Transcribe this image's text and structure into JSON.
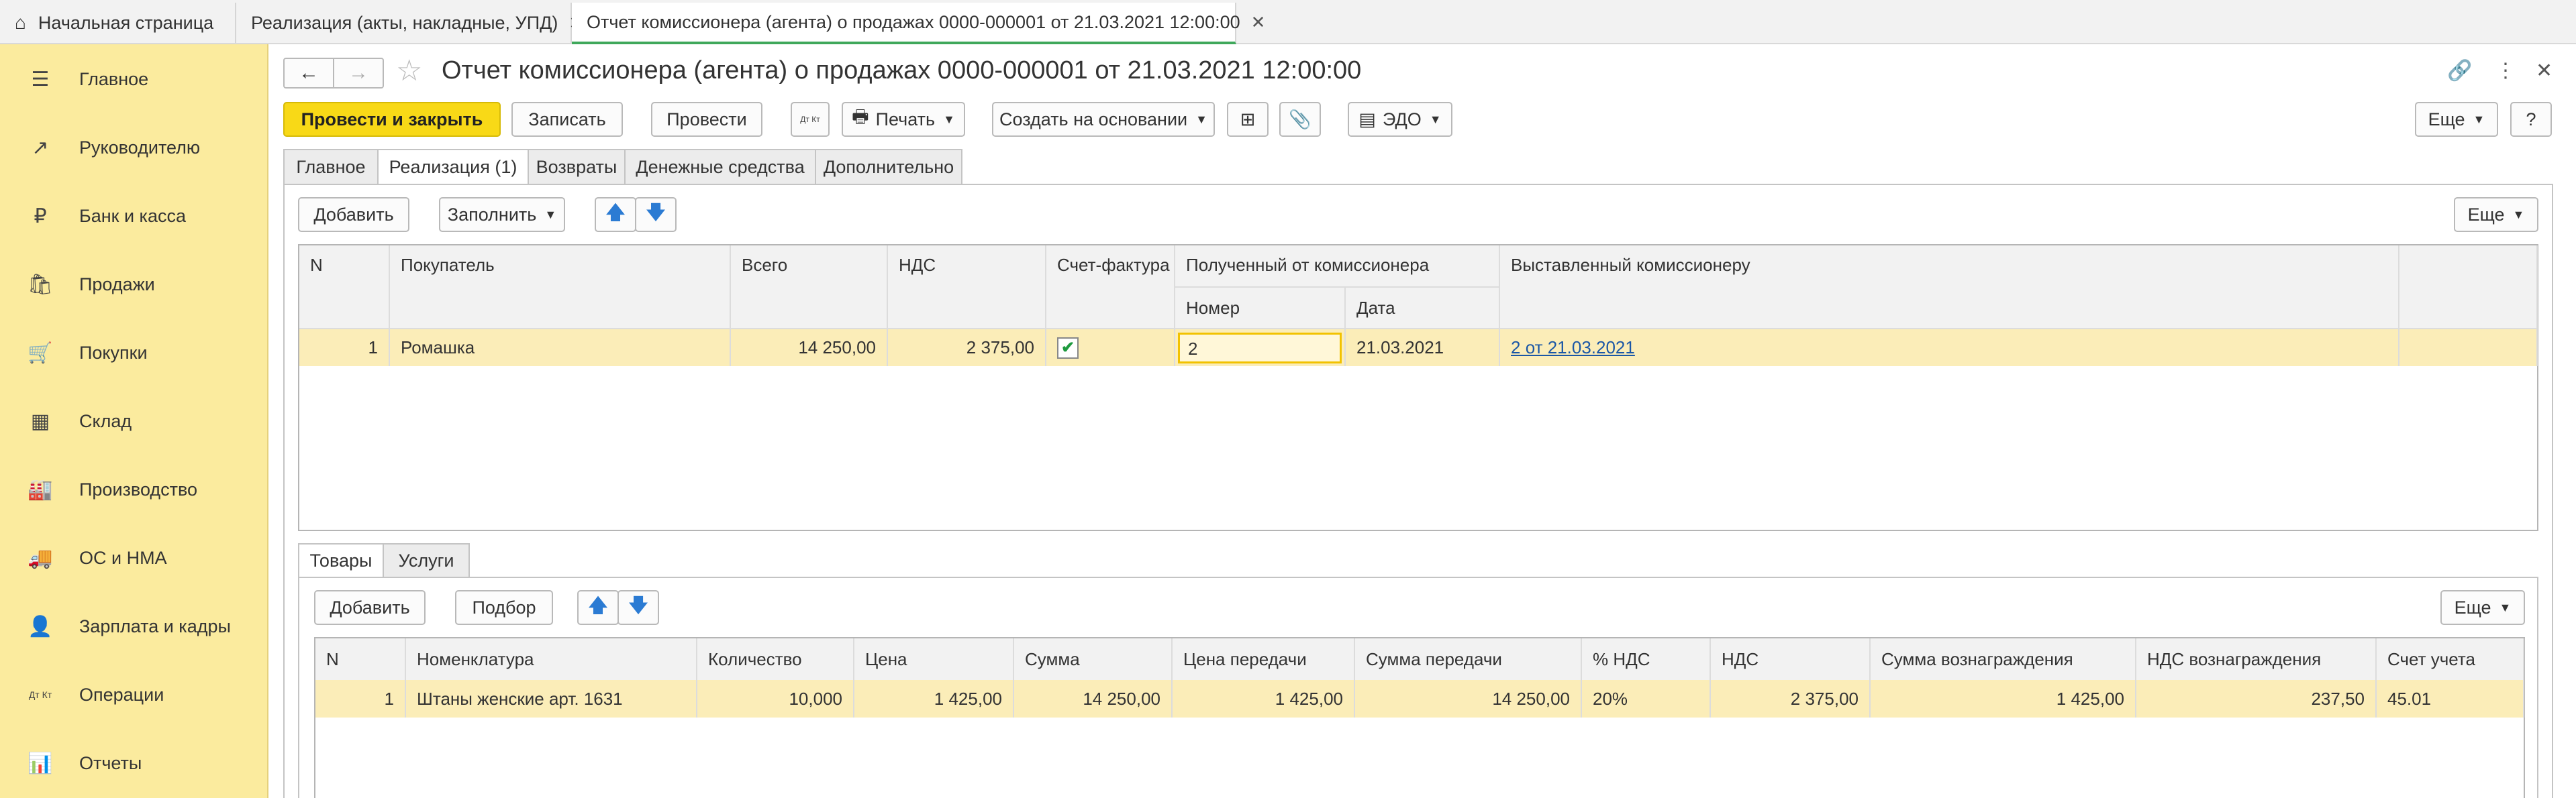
{
  "tabs": [
    {
      "label": "Начальная страница",
      "icon": "home-icon"
    },
    {
      "label": "Реализация (акты, накладные, УПД)",
      "close": "✕"
    },
    {
      "label": "Отчет комиссионера (агента) о продажах 0000-000001 от 21.03.2021 12:00:00",
      "close": "✕"
    }
  ],
  "sidebar": {
    "items": [
      {
        "label": "Главное",
        "icon": "☰"
      },
      {
        "label": "Руководителю",
        "icon": "↗"
      },
      {
        "label": "Банк и касса",
        "icon": "₽"
      },
      {
        "label": "Продажи",
        "icon": "🛍"
      },
      {
        "label": "Покупки",
        "icon": "🛒"
      },
      {
        "label": "Склад",
        "icon": "▦"
      },
      {
        "label": "Производство",
        "icon": "🏭"
      },
      {
        "label": "ОС и НМА",
        "icon": "🚚"
      },
      {
        "label": "Зарплата и кадры",
        "icon": "👤"
      },
      {
        "label": "Операции",
        "icon": "Дт Кт"
      },
      {
        "label": "Отчеты",
        "icon": "📊"
      }
    ]
  },
  "header": {
    "title": "Отчет комиссионера (агента) о продажах 0000-000001 от 21.03.2021 12:00:00",
    "back": "←",
    "forward": "→",
    "star": "☆",
    "link": "🔗",
    "more": "⋮",
    "close": "✕"
  },
  "toolbar": {
    "post_close": "Провести и закрыть",
    "save": "Записать",
    "post": "Провести",
    "dtkt": "Дт Кт",
    "print": "Печать",
    "create_based": "Создать на основании",
    "edo": "ЭДО",
    "more": "Еще",
    "help": "?"
  },
  "doc_tabs": [
    "Главное",
    "Реализация (1)",
    "Возвраты",
    "Денежные средства",
    "Дополнительно"
  ],
  "sales": {
    "add": "Добавить",
    "fill": "Заполнить",
    "more": "Еще",
    "headers": {
      "n": "N",
      "buyer": "Покупатель",
      "total": "Всего",
      "vat": "НДС",
      "invoice": "Счет-фактура",
      "received": "Полученный от комиссионера",
      "number": "Номер",
      "date": "Дата",
      "issued": "Выставленный комиссионеру"
    },
    "rows": [
      {
        "n": "1",
        "buyer": "Ромашка",
        "total": "14 250,00",
        "vat": "2 375,00",
        "invoice_checked": "✔",
        "number": "2",
        "date": "21.03.2021",
        "issued": "2 от 21.03.2021"
      }
    ]
  },
  "inner_tabs": [
    "Товары",
    "Услуги"
  ],
  "goods": {
    "add": "Добавить",
    "pick": "Подбор",
    "more": "Еще",
    "headers": [
      "N",
      "Номенклатура",
      "Количество",
      "Цена",
      "Сумма",
      "Цена передачи",
      "Сумма передачи",
      "% НДС",
      "НДС",
      "Сумма вознаграждения",
      "НДС вознаграждения",
      "Счет учета"
    ],
    "rows": [
      [
        "1",
        "Штаны женские арт. 1631",
        "10,000",
        "1 425,00",
        "14 250,00",
        "1 425,00",
        "14 250,00",
        "20%",
        "2 375,00",
        "1 425,00",
        "237,50",
        "45.01"
      ]
    ]
  }
}
